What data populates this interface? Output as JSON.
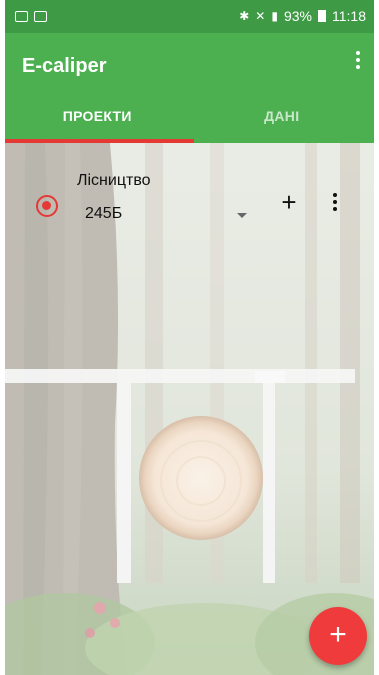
{
  "status_bar": {
    "battery_percent": "93%",
    "time": "11:18"
  },
  "app_bar": {
    "title": "E-caliper"
  },
  "tabs": [
    {
      "label": "ПРОЕКТИ",
      "selected": true
    },
    {
      "label": "ДАНІ",
      "selected": false
    }
  ],
  "project": {
    "name": "Лісництво",
    "selected_value": "245Б",
    "selected": true
  },
  "colors": {
    "primary": "#4caf50",
    "status_bar": "#3f9a45",
    "accent": "#ef3b3b"
  },
  "icons": {
    "fab": "plus-icon",
    "row_add": "plus-icon",
    "menu": "more-vert-icon"
  }
}
